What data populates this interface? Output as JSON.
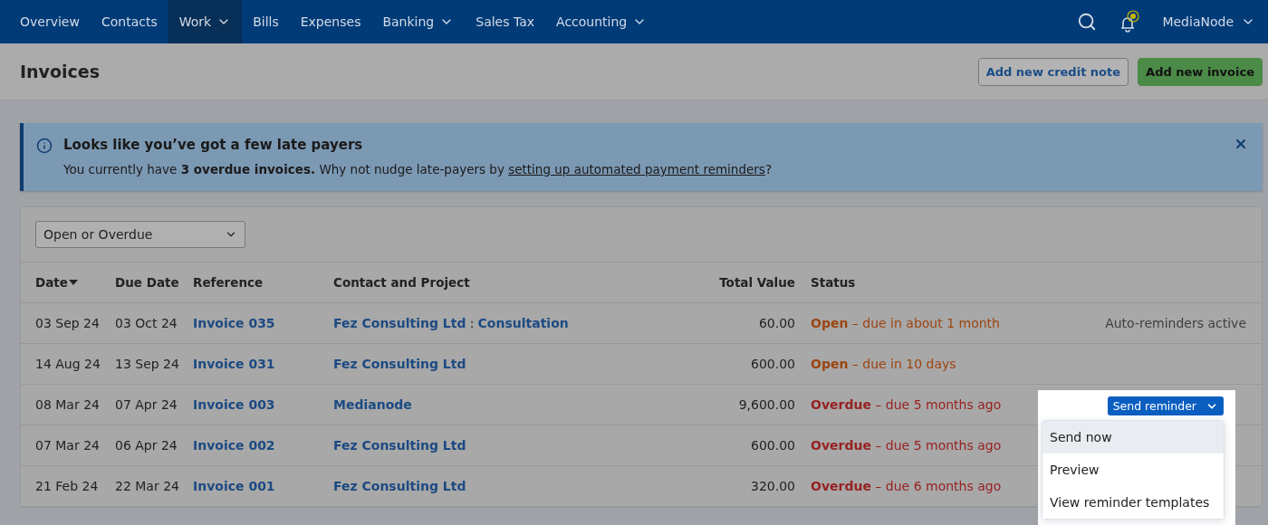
{
  "nav": {
    "items": [
      {
        "label": "Overview",
        "selected": false,
        "dropdown": false
      },
      {
        "label": "Contacts",
        "selected": false,
        "dropdown": false
      },
      {
        "label": "Work",
        "selected": true,
        "dropdown": true
      },
      {
        "label": "Bills",
        "selected": false,
        "dropdown": false
      },
      {
        "label": "Expenses",
        "selected": false,
        "dropdown": false
      },
      {
        "label": "Banking",
        "selected": false,
        "dropdown": true
      },
      {
        "label": "Sales Tax",
        "selected": false,
        "dropdown": false
      },
      {
        "label": "Accounting",
        "selected": false,
        "dropdown": true
      }
    ],
    "account": "MediaNode"
  },
  "header": {
    "title": "Invoices",
    "buttons": [
      {
        "label": "Add new credit note",
        "kind": "secondary"
      },
      {
        "label": "Add new invoice",
        "kind": "primary"
      }
    ]
  },
  "banner": {
    "title": "Looks like you’ve got a few late payers",
    "message": "You currently have **3 overdue invoices.** Why not nudge late-payers by ",
    "link": "setting up automated payment reminders",
    "end": "?"
  },
  "filter": {
    "value": "Open or Overdue"
  },
  "table": {
    "columns": [
      {
        "label": "Date",
        "sorted": true
      },
      {
        "label": "Due Date",
        "sorted": false
      },
      {
        "label": "Reference",
        "sorted": false
      },
      {
        "label": "Contact and Project",
        "sorted": false
      },
      {
        "label": "Total Value",
        "sorted": false
      },
      {
        "label": "Status",
        "sorted": false
      }
    ],
    "rows": [
      {
        "date": "03 Sep 24",
        "due": "03 Oct 24",
        "reference": "Invoice 035",
        "contact": "Fez Consulting Ltd",
        "separator": ":",
        "project": "Consultation",
        "total": "60.00",
        "status": {
          "kind": "open",
          "label": "Open",
          "detail": " – due in about 1 month"
        },
        "action": {
          "kind": "note",
          "label": "Auto-reminders active"
        }
      },
      {
        "date": "14 Aug 24",
        "due": "13 Sep 24",
        "reference": "Invoice 031",
        "contact": "Fez Consulting Ltd",
        "total": "600.00",
        "status": {
          "kind": "open",
          "label": "Open",
          "detail": " – due in 10 days"
        }
      },
      {
        "date": "08 Mar 24",
        "due": "07 Apr 24",
        "reference": "Invoice 003",
        "contact": "Medianode",
        "total": "9,600.00",
        "status": {
          "kind": "overdue",
          "label": "Overdue",
          "detail": " – due 5 months ago"
        },
        "action": {
          "kind": "menu",
          "label": "Send reminder",
          "items": [
            {
              "label": "Send now",
              "selected": true
            },
            {
              "label": "Preview",
              "selected": false
            },
            {
              "label": "View reminder templates",
              "selected": false
            }
          ]
        }
      },
      {
        "date": "07 Mar 24",
        "due": "06 Apr 24",
        "reference": "Invoice 002",
        "contact": "Fez Consulting Ltd",
        "total": "600.00",
        "status": {
          "kind": "overdue",
          "label": "Overdue",
          "detail": " – due 5 months ago"
        }
      },
      {
        "date": "21 Feb 24",
        "due": "22 Mar 24",
        "reference": "Invoice 001",
        "contact": "Fez Consulting Ltd",
        "total": "320.00",
        "status": {
          "kind": "overdue",
          "label": "Overdue",
          "detail": " – due 6 months ago"
        }
      }
    ]
  }
}
